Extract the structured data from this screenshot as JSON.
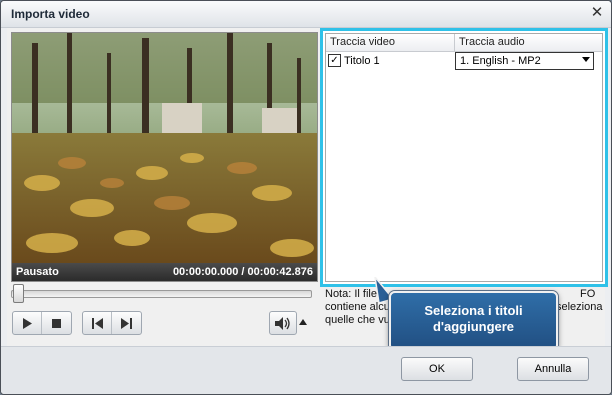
{
  "window": {
    "title": "Importa video"
  },
  "player": {
    "state": "Pausato",
    "time": "00:00:00.000  /  00:00:42.876"
  },
  "tracks": {
    "headers": [
      "Traccia video",
      "Traccia audio"
    ],
    "rows": [
      {
        "checked": true,
        "title": "Titolo 1",
        "audio": "1. English - MP2"
      }
    ]
  },
  "note": {
    "line1_left": "Nota: Il file L",
    "line1_right": "FO",
    "line2_left": "contiene alcu",
    "line2_right": "seleziona",
    "line3_left": "quelle che vu"
  },
  "callout": {
    "text_line1": "Seleziona i titoli",
    "text_line2": "d'aggiungere"
  },
  "buttons": {
    "ok": "OK",
    "cancel": "Annulla"
  },
  "colors": {
    "highlight": "#2fc1e8",
    "callout": "#2a5f96"
  },
  "icons": [
    "close-icon",
    "play-icon",
    "stop-icon",
    "prev-icon",
    "next-icon",
    "speaker-icon",
    "arrow-up-icon"
  ]
}
